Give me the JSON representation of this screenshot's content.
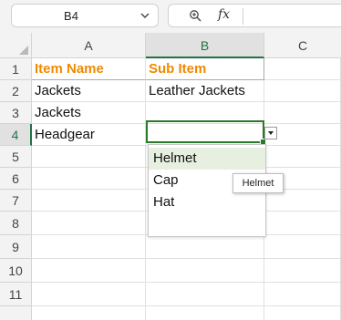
{
  "formula_bar": {
    "name_box": "B4",
    "zoom_icon": "magnifier-icon",
    "fx_label": "fx",
    "formula": ""
  },
  "columns": [
    "A",
    "B",
    "C"
  ],
  "rows": [
    "1",
    "2",
    "3",
    "4",
    "5",
    "6",
    "7",
    "8",
    "9",
    "10",
    "11"
  ],
  "cells": {
    "A1": "Item Name",
    "B1": "Sub Item",
    "A2": "Jackets",
    "B2": "Leather Jackets",
    "A3": "Jackets",
    "A4": "Headgear",
    "B4": ""
  },
  "active_cell": "B4",
  "dropdown": {
    "options": [
      "Helmet",
      "Cap",
      "Hat"
    ],
    "highlighted": "Helmet",
    "tooltip": "Helmet"
  },
  "colors": {
    "header_text": "#f08a00",
    "selection": "#2b7a2b",
    "highlight": "#e6efe0"
  }
}
